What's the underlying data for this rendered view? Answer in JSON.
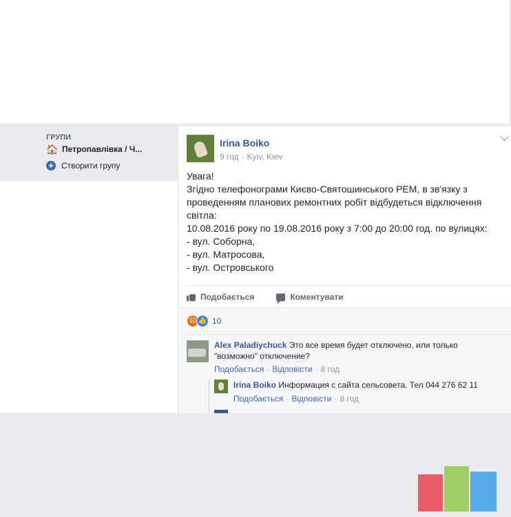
{
  "sidebar": {
    "heading": "ГРУПИ",
    "group_name": "Петропавлівка / Ч...",
    "create_group": "Створити групу"
  },
  "post": {
    "author": "Irina Boiko",
    "time": "9 год",
    "location": "Kyiv, Kiev",
    "lines": [
      "Увага!",
      "Згідно телефонограми Києво-Святошинського РЕМ, в зв'язку з",
      "проведенням планових ремонтних робіт відбудеться відключення",
      "світла:",
      "10.08.2016 року по 19.08.2016 року з 7:00 до 20:00 год. по вулицях:",
      "- вул. Соборна,",
      "- вул. Матросова,",
      "- вул. Островського"
    ],
    "actions": {
      "like": "Подобається",
      "comment": "Коментувати"
    },
    "reaction_count": "10"
  },
  "comments": [
    {
      "author": "Alex Paladiychuck",
      "text_line1": "Это все время будет отключено, или только",
      "text_line2": "\"возможно\" отключение?",
      "like": "Подобається",
      "reply": "Відповісти",
      "time": "8 год"
    }
  ],
  "reply": {
    "author": "Irina Boiko",
    "text": "Информация с сайта сельсовета. Тел 044 276 62 11",
    "like": "Подобається",
    "reply": "Відповісти",
    "time": "8 год"
  },
  "icons": {
    "group": "home-icon",
    "create": "plus-icon",
    "location": "globe-icon",
    "like": "thumbs-up-icon",
    "comment": "speech-bubble-icon",
    "reaction_angry": "angry-reaction-icon",
    "reaction_like": "like-reaction-icon"
  },
  "colors": {
    "link": "#365899",
    "accent": "#4267b2",
    "page_background": "#e9ebee"
  }
}
